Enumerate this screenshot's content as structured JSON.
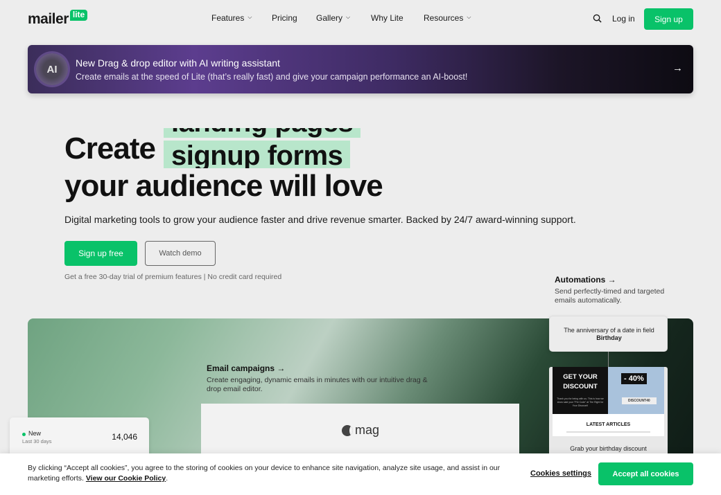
{
  "nav": {
    "logo_text": "mailer",
    "logo_badge": "lite",
    "links": [
      {
        "label": "Features",
        "has_dropdown": true
      },
      {
        "label": "Pricing",
        "has_dropdown": false
      },
      {
        "label": "Gallery",
        "has_dropdown": true
      },
      {
        "label": "Why Lite",
        "has_dropdown": false
      },
      {
        "label": "Resources",
        "has_dropdown": true
      }
    ],
    "login": "Log in",
    "signup": "Sign up"
  },
  "banner": {
    "badge": "AI",
    "title": "New Drag & drop editor with AI writing assistant",
    "subtitle": "Create emails at the speed of Lite (that’s really fast) and give your campaign performance an AI-boost!",
    "arrow": "→"
  },
  "hero": {
    "word_create": "Create",
    "rotating_words": [
      "landing pages",
      "signup forms"
    ],
    "line2": "your audience will love",
    "description": "Digital marketing tools to grow your audience faster and drive revenue smarter. Backed by 24/7 award-winning support.",
    "primary_cta": "Sign up free",
    "secondary_cta": "Watch demo",
    "trial_note": "Get a free 30-day trial of premium features | No credit card required"
  },
  "automations": {
    "title": "Automations →",
    "description": "Send perfectly-timed and targeted emails automatically.",
    "trigger_text": "The anniversary of a date in field",
    "trigger_field": "Birthday",
    "email_headline": "GET YOUR DISCOUNT",
    "email_small": "Thank you for being with us. This is how we show said your \"Pre Code\" at The Right for Your Discount!",
    "discount": "- 40%",
    "discount_code": "DISCOUNT40",
    "latest_articles": "LATEST ARTICLES",
    "caption": "Grab your birthday discount"
  },
  "email_campaigns": {
    "title": "Email campaigns →",
    "description": "Create engaging, dynamic emails in minutes with our intuitive drag & drop email editor.",
    "preview_logo": "mag"
  },
  "stats": {
    "label": "New",
    "period": "Last 30 days",
    "value": "14,046"
  },
  "cookie": {
    "text": "By clicking “Accept all cookies”, you agree to the storing of cookies on your device to enhance site navigation, analyze site usage, and assist in our marketing efforts.",
    "policy_link": "View our Cookie Policy",
    "settings": "Cookies settings",
    "accept": "Accept all cookies"
  },
  "colors": {
    "brand_green": "#09c269",
    "highlight_green": "#b8e6cb",
    "banner_purple": "#5c3d8e"
  }
}
